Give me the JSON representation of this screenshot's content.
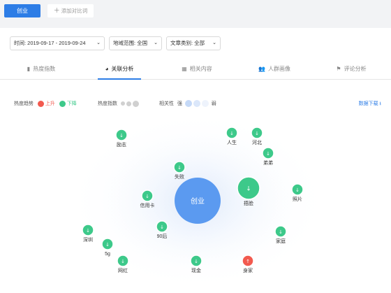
{
  "header": {
    "keyword_tab": "创业",
    "add_compare": "添加对比词"
  },
  "filters": {
    "time": "时间: 2019-09-17 - 2019-09-24",
    "region": "地域范围: 全国",
    "category": "文章类别: 全部"
  },
  "tabs": [
    {
      "label": "热度指数",
      "icon": "bar-chart-icon"
    },
    {
      "label": "关联分析",
      "icon": "pie-chart-icon"
    },
    {
      "label": "相关内容",
      "icon": "grid-icon"
    },
    {
      "label": "人群画像",
      "icon": "people-icon"
    },
    {
      "label": "评论分析",
      "icon": "comment-icon"
    }
  ],
  "legend": {
    "trend_label": "热度趋势",
    "up": "上升",
    "down": "下降",
    "heat_label": "热度指数",
    "relevance_label": "相关性",
    "strong": "强",
    "weak": "弱",
    "download": "数据下载"
  },
  "colors": {
    "accent": "#2d7de6",
    "up": "#f25a4f",
    "down": "#3dc98a",
    "center": "#5b9af0"
  },
  "graph": {
    "center": "创业",
    "nodes": [
      {
        "label": "励志",
        "trend": "down",
        "size": "small"
      },
      {
        "label": "人生",
        "trend": "down",
        "size": "small"
      },
      {
        "label": "河北",
        "trend": "down",
        "size": "small"
      },
      {
        "label": "弟弟",
        "trend": "down",
        "size": "small"
      },
      {
        "label": "失败",
        "trend": "down",
        "size": "small"
      },
      {
        "label": "信用卡",
        "trend": "down",
        "size": "small"
      },
      {
        "label": "捂脸",
        "trend": "down",
        "size": "large"
      },
      {
        "label": "照片",
        "trend": "down",
        "size": "small"
      },
      {
        "label": "90后",
        "trend": "down",
        "size": "small"
      },
      {
        "label": "深圳",
        "trend": "down",
        "size": "small"
      },
      {
        "label": "5g",
        "trend": "down",
        "size": "small"
      },
      {
        "label": "家庭",
        "trend": "down",
        "size": "small"
      },
      {
        "label": "网红",
        "trend": "down",
        "size": "small"
      },
      {
        "label": "现金",
        "trend": "down",
        "size": "small"
      },
      {
        "label": "身家",
        "trend": "up",
        "size": "small"
      }
    ]
  }
}
